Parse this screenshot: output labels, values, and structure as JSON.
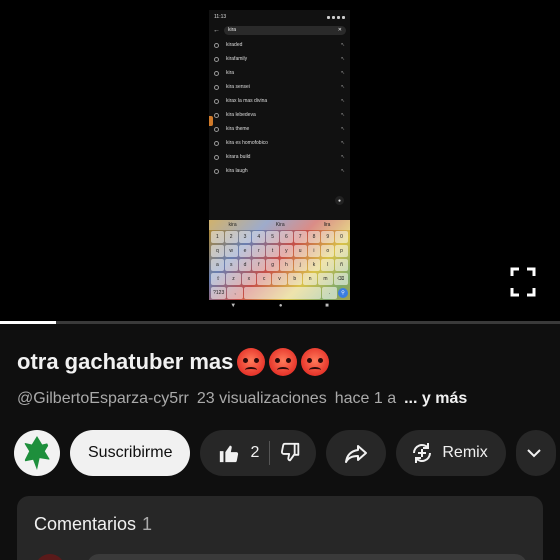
{
  "player": {
    "phone": {
      "status_time": "11:13",
      "search_query": "kira",
      "suggestions": [
        "kiraded",
        "kirafamily",
        "kira",
        "kira sensei",
        "kirax la mas divina",
        "kira lebedeva",
        "kira theme",
        "kira es homofobico",
        "kirara build",
        "kira laugh"
      ],
      "keyboard_suggestions": [
        "kira",
        "Kira",
        "lira"
      ],
      "keyboard_rows": [
        [
          "1",
          "2",
          "3",
          "4",
          "5",
          "6",
          "7",
          "8",
          "9",
          "0"
        ],
        [
          "q",
          "w",
          "e",
          "r",
          "t",
          "y",
          "u",
          "i",
          "o",
          "p"
        ],
        [
          "a",
          "s",
          "d",
          "f",
          "g",
          "h",
          "j",
          "k",
          "l",
          "ñ"
        ],
        [
          "⇧",
          "z",
          "x",
          "c",
          "v",
          "b",
          "n",
          "m",
          "⌫"
        ]
      ],
      "keyboard_bottom": {
        "symbols": "?123",
        "comma": ",",
        "period": "."
      }
    },
    "progress_fraction": 0.1
  },
  "video": {
    "title": "otra gachatuber mas",
    "channel_handle": "@GilbertoEsparza-cy5rr",
    "views": "23 visualizaciones",
    "age": "hace 1 a",
    "more": "... y más"
  },
  "actions": {
    "subscribe_label": "Suscribirme",
    "like_count": "2",
    "remix_label": "Remix"
  },
  "comments": {
    "heading": "Comentarios",
    "count": "1"
  },
  "icons": {
    "emoji": "angry-face",
    "like": "thumbs-up-icon",
    "dislike": "thumbs-down-icon",
    "share": "share-icon",
    "remix": "remix-icon",
    "fullscreen": "fullscreen-icon"
  }
}
